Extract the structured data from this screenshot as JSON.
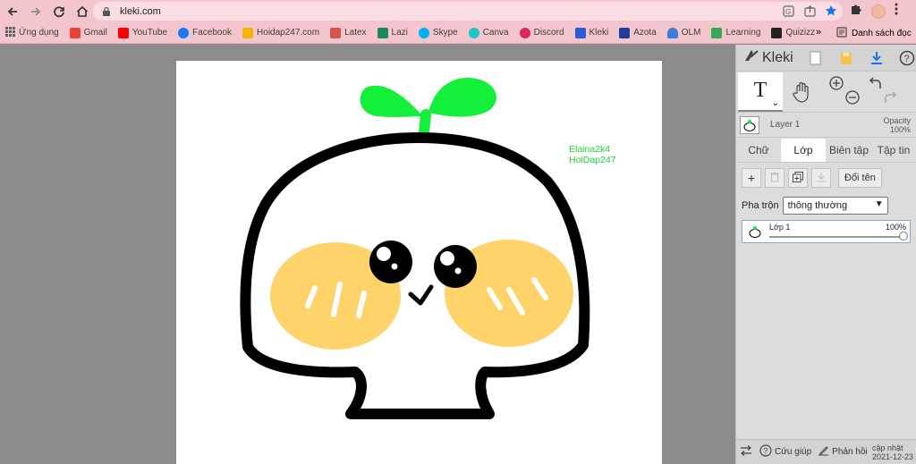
{
  "browser": {
    "url": "kleki.com",
    "accent": "#f3c6ce"
  },
  "bookmarks": [
    {
      "label": "Ứng dụng",
      "icon": "apps-grid-icon",
      "color": "#4285f4"
    },
    {
      "label": "Gmail",
      "icon": "gmail-icon",
      "color": "#ea4335"
    },
    {
      "label": "YouTube",
      "icon": "youtube-icon",
      "color": "#ff0000"
    },
    {
      "label": "Facebook",
      "icon": "facebook-icon",
      "color": "#1877f2"
    },
    {
      "label": "Hoidap247.com",
      "icon": "hoidap-icon",
      "color": "#f4b400"
    },
    {
      "label": "Latex",
      "icon": "latex-icon",
      "color": "#d9534f"
    },
    {
      "label": "Lazi",
      "icon": "lazi-icon",
      "color": "#1b8a5a"
    },
    {
      "label": "Skype",
      "icon": "skype-icon",
      "color": "#00aff0"
    },
    {
      "label": "Canva",
      "icon": "canva-icon",
      "color": "#20c4cb"
    },
    {
      "label": "Discord",
      "icon": "discord-icon",
      "color": "#e0245e"
    },
    {
      "label": "Kleki",
      "icon": "kleki-icon",
      "color": "#2a5bd7"
    },
    {
      "label": "Azota",
      "icon": "azota-icon",
      "color": "#1f3d99"
    },
    {
      "label": "OLM",
      "icon": "olm-icon",
      "color": "#3b7ddd"
    },
    {
      "label": "Learning",
      "icon": "learning-icon",
      "color": "#34a853"
    },
    {
      "label": "Quizizz",
      "icon": "quizizz-icon",
      "color": "#222222"
    }
  ],
  "bookmarks_more": "»",
  "reading_list": "Danh sách đọc",
  "canvas": {
    "watermark_line1": "Elaina2k4",
    "watermark_line2": "HoiDap247"
  },
  "panel": {
    "logo": "Kleki",
    "layer_name": "Layer 1",
    "opacity_label": "Opacity",
    "opacity_value": "100%",
    "tabs": [
      {
        "label": "Chữ",
        "active": false
      },
      {
        "label": "Lớp",
        "active": true
      },
      {
        "label": "Biên tập",
        "active": false
      },
      {
        "label": "Tập tin",
        "active": false
      }
    ],
    "rename_label": "Đổi tên",
    "blend_label": "Pha trộn",
    "blend_value": "thông thường",
    "layer_item_name": "Lớp 1",
    "layer_item_opacity": "100%",
    "footer": {
      "help": "Cứu giúp",
      "feedback": "Phản hồi",
      "update_label": "cập nhật",
      "update_date": "2021-12-23"
    }
  }
}
